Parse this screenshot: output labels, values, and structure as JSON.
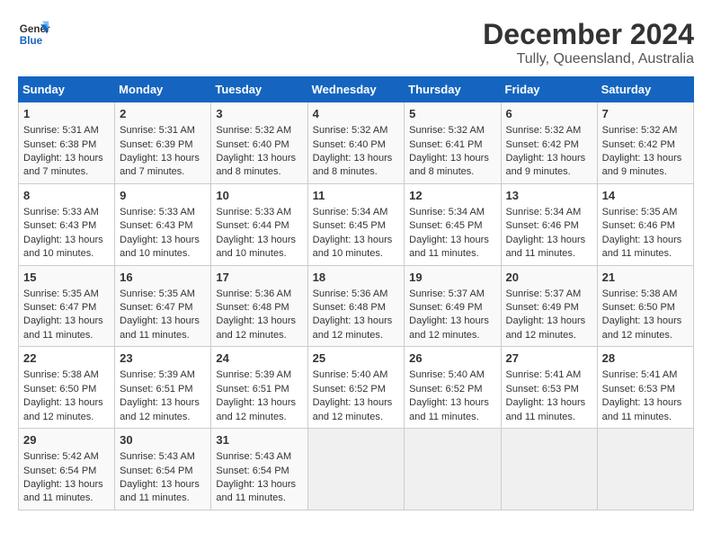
{
  "logo": {
    "line1": "General",
    "line2": "Blue"
  },
  "title": "December 2024",
  "location": "Tully, Queensland, Australia",
  "days_of_week": [
    "Sunday",
    "Monday",
    "Tuesday",
    "Wednesday",
    "Thursday",
    "Friday",
    "Saturday"
  ],
  "weeks": [
    [
      {
        "day": "1",
        "sunrise": "5:31 AM",
        "sunset": "6:38 PM",
        "daylight": "13 hours and 7 minutes."
      },
      {
        "day": "2",
        "sunrise": "5:31 AM",
        "sunset": "6:39 PM",
        "daylight": "13 hours and 7 minutes."
      },
      {
        "day": "3",
        "sunrise": "5:32 AM",
        "sunset": "6:40 PM",
        "daylight": "13 hours and 8 minutes."
      },
      {
        "day": "4",
        "sunrise": "5:32 AM",
        "sunset": "6:40 PM",
        "daylight": "13 hours and 8 minutes."
      },
      {
        "day": "5",
        "sunrise": "5:32 AM",
        "sunset": "6:41 PM",
        "daylight": "13 hours and 8 minutes."
      },
      {
        "day": "6",
        "sunrise": "5:32 AM",
        "sunset": "6:42 PM",
        "daylight": "13 hours and 9 minutes."
      },
      {
        "day": "7",
        "sunrise": "5:32 AM",
        "sunset": "6:42 PM",
        "daylight": "13 hours and 9 minutes."
      }
    ],
    [
      {
        "day": "8",
        "sunrise": "5:33 AM",
        "sunset": "6:43 PM",
        "daylight": "13 hours and 10 minutes."
      },
      {
        "day": "9",
        "sunrise": "5:33 AM",
        "sunset": "6:43 PM",
        "daylight": "13 hours and 10 minutes."
      },
      {
        "day": "10",
        "sunrise": "5:33 AM",
        "sunset": "6:44 PM",
        "daylight": "13 hours and 10 minutes."
      },
      {
        "day": "11",
        "sunrise": "5:34 AM",
        "sunset": "6:45 PM",
        "daylight": "13 hours and 10 minutes."
      },
      {
        "day": "12",
        "sunrise": "5:34 AM",
        "sunset": "6:45 PM",
        "daylight": "13 hours and 11 minutes."
      },
      {
        "day": "13",
        "sunrise": "5:34 AM",
        "sunset": "6:46 PM",
        "daylight": "13 hours and 11 minutes."
      },
      {
        "day": "14",
        "sunrise": "5:35 AM",
        "sunset": "6:46 PM",
        "daylight": "13 hours and 11 minutes."
      }
    ],
    [
      {
        "day": "15",
        "sunrise": "5:35 AM",
        "sunset": "6:47 PM",
        "daylight": "13 hours and 11 minutes."
      },
      {
        "day": "16",
        "sunrise": "5:35 AM",
        "sunset": "6:47 PM",
        "daylight": "13 hours and 11 minutes."
      },
      {
        "day": "17",
        "sunrise": "5:36 AM",
        "sunset": "6:48 PM",
        "daylight": "13 hours and 12 minutes."
      },
      {
        "day": "18",
        "sunrise": "5:36 AM",
        "sunset": "6:48 PM",
        "daylight": "13 hours and 12 minutes."
      },
      {
        "day": "19",
        "sunrise": "5:37 AM",
        "sunset": "6:49 PM",
        "daylight": "13 hours and 12 minutes."
      },
      {
        "day": "20",
        "sunrise": "5:37 AM",
        "sunset": "6:49 PM",
        "daylight": "13 hours and 12 minutes."
      },
      {
        "day": "21",
        "sunrise": "5:38 AM",
        "sunset": "6:50 PM",
        "daylight": "13 hours and 12 minutes."
      }
    ],
    [
      {
        "day": "22",
        "sunrise": "5:38 AM",
        "sunset": "6:50 PM",
        "daylight": "13 hours and 12 minutes."
      },
      {
        "day": "23",
        "sunrise": "5:39 AM",
        "sunset": "6:51 PM",
        "daylight": "13 hours and 12 minutes."
      },
      {
        "day": "24",
        "sunrise": "5:39 AM",
        "sunset": "6:51 PM",
        "daylight": "13 hours and 12 minutes."
      },
      {
        "day": "25",
        "sunrise": "5:40 AM",
        "sunset": "6:52 PM",
        "daylight": "13 hours and 12 minutes."
      },
      {
        "day": "26",
        "sunrise": "5:40 AM",
        "sunset": "6:52 PM",
        "daylight": "13 hours and 11 minutes."
      },
      {
        "day": "27",
        "sunrise": "5:41 AM",
        "sunset": "6:53 PM",
        "daylight": "13 hours and 11 minutes."
      },
      {
        "day": "28",
        "sunrise": "5:41 AM",
        "sunset": "6:53 PM",
        "daylight": "13 hours and 11 minutes."
      }
    ],
    [
      {
        "day": "29",
        "sunrise": "5:42 AM",
        "sunset": "6:54 PM",
        "daylight": "13 hours and 11 minutes."
      },
      {
        "day": "30",
        "sunrise": "5:43 AM",
        "sunset": "6:54 PM",
        "daylight": "13 hours and 11 minutes."
      },
      {
        "day": "31",
        "sunrise": "5:43 AM",
        "sunset": "6:54 PM",
        "daylight": "13 hours and 11 minutes."
      },
      null,
      null,
      null,
      null
    ]
  ]
}
